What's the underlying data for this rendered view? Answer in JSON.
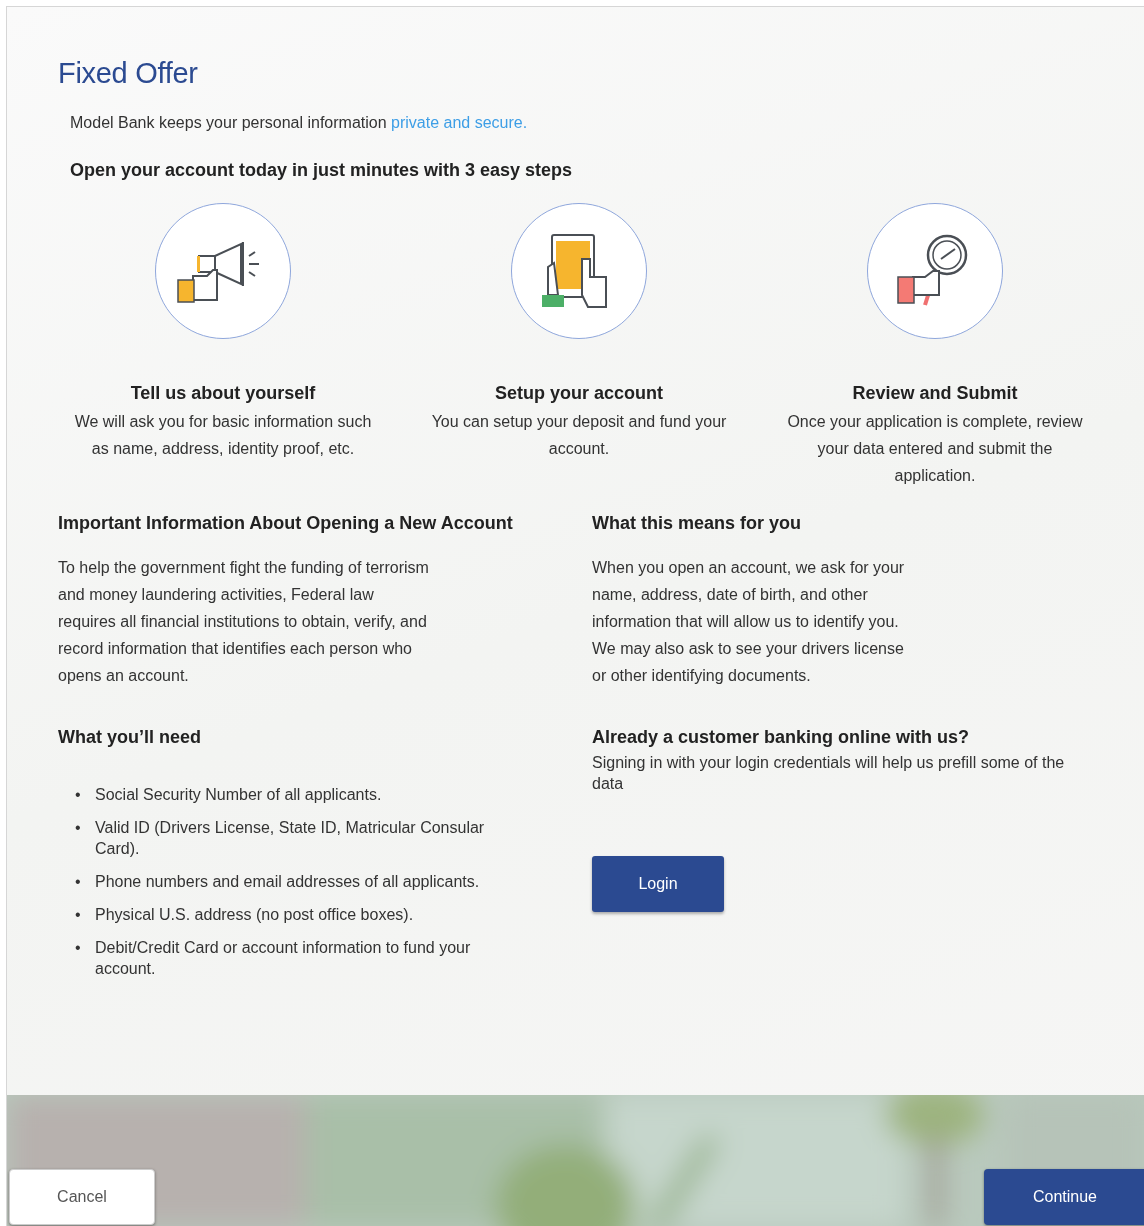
{
  "title": "Fixed Offer",
  "privacy": {
    "text": "Model Bank keeps your personal information",
    "link": "private and secure."
  },
  "steps_heading": "Open your account today in just minutes with 3 easy steps",
  "steps": [
    {
      "kind": "megaphone",
      "title": "Tell us about yourself",
      "text": "We will ask you for basic information such as name, address, identity proof, etc."
    },
    {
      "kind": "tablet",
      "title": "Setup your account",
      "text": "You can setup your deposit and fund your account."
    },
    {
      "kind": "magnifier",
      "title": "Review and Submit",
      "text": "Once your application is complete, review your data entered and submit the application."
    }
  ],
  "important": {
    "heading": "Important Information About Opening a New Account",
    "text": "To help the government fight the funding of terrorism and money laundering activities, Federal law requires all financial institutions to obtain, verify, and record information that identifies each person who opens an account."
  },
  "means": {
    "heading": "What this means for you",
    "text": "When you open an account, we ask for your name, address, date of birth, and other information that will allow us to identify you. We may also ask to see your drivers license or other identifying documents."
  },
  "need": {
    "heading": "What you’ll need",
    "items": [
      {
        "marker": "•",
        "text": "Social Security Number of all applicants."
      },
      {
        "marker": "•",
        "text": "Valid ID (Drivers License, State ID, Matricular Consular Card)."
      },
      {
        "marker": "•",
        "text": "Phone numbers and email addresses of all applicants."
      },
      {
        "marker": "•",
        "text": "Physical U.S. address (no post office boxes)."
      },
      {
        "marker": "•",
        "text": "Debit/Credit Card or account information to fund your account."
      }
    ]
  },
  "existing": {
    "heading": "Already a customer banking online with us?",
    "text": "Signing in with your login credentials will help us prefill some of the data",
    "button": "Login"
  },
  "footer": {
    "cancel": "Cancel",
    "continue": "Continue"
  }
}
